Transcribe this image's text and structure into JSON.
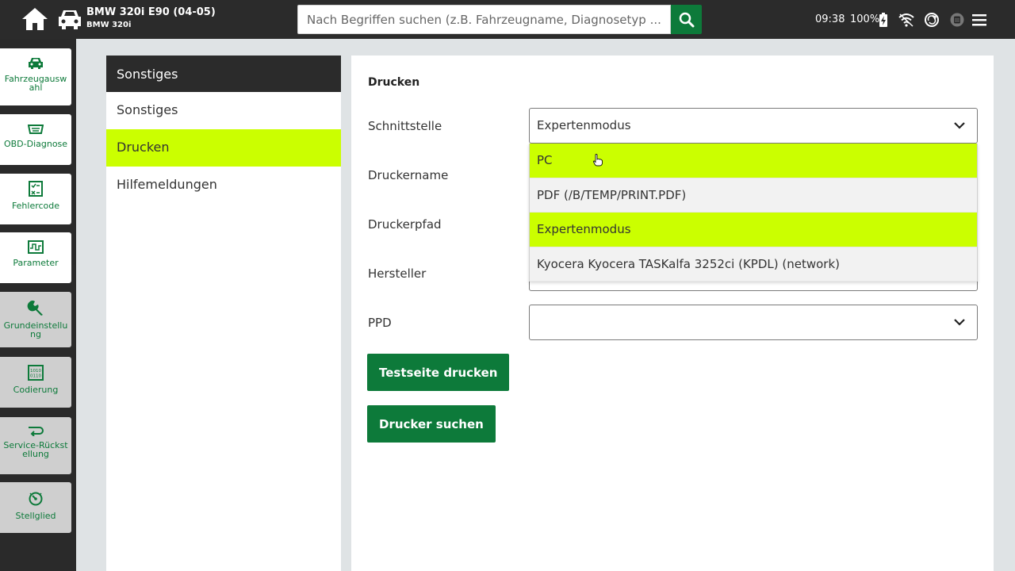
{
  "header": {
    "vehicle_title": "BMW 320i E90 (04-05)",
    "vehicle_subtitle": "BMW 320i",
    "search_placeholder": "Nach Begriffen suchen (z.B. Fahrzeugname, Diagnosetyp ...",
    "time": "09:38",
    "battery": "100%"
  },
  "sidebar": {
    "items": [
      {
        "label": "Fahrzeugauswahl",
        "icon": "car-icon",
        "state": "active"
      },
      {
        "label": "OBD-Diagnose",
        "icon": "obd-icon",
        "state": "active"
      },
      {
        "label": "Fehlercode",
        "icon": "checklist-icon",
        "state": "active"
      },
      {
        "label": "Parameter",
        "icon": "waveform-icon",
        "state": "active"
      },
      {
        "label": "Grundeinstellung",
        "icon": "wrench-icon",
        "state": "inactive"
      },
      {
        "label": "Codierung",
        "icon": "binary-icon",
        "state": "inactive"
      },
      {
        "label": "Service-Rückstellung",
        "icon": "return-arrow-icon",
        "state": "inactive"
      },
      {
        "label": "Stellglied",
        "icon": "gauge-icon",
        "state": "inactive"
      }
    ]
  },
  "settings_menu": {
    "header": "Sonstiges",
    "items": [
      "Sonstiges",
      "Drucken",
      "Hilfemeldungen"
    ],
    "selected": "Drucken"
  },
  "print_settings": {
    "title": "Drucken",
    "labels": {
      "interface": "Schnittstelle",
      "printer_name": "Druckername",
      "printer_path": "Druckerpfad",
      "manufacturer": "Hersteller",
      "ppd": "PPD"
    },
    "interface_value": "Expertenmodus",
    "ppd_value": "",
    "dropdown_options": [
      "PC",
      "PDF (/B/TEMP/PRINT.PDF)",
      "Expertenmodus",
      "Kyocera Kyocera TASKalfa 3252ci (KPDL) (network)"
    ],
    "test_print_button": "Testseite drucken",
    "find_printer_button": "Drucker suchen"
  },
  "colors": {
    "brand_green": "#0d7a3a",
    "highlight": "#cbff00",
    "dark_bar": "#2b2b2b"
  }
}
